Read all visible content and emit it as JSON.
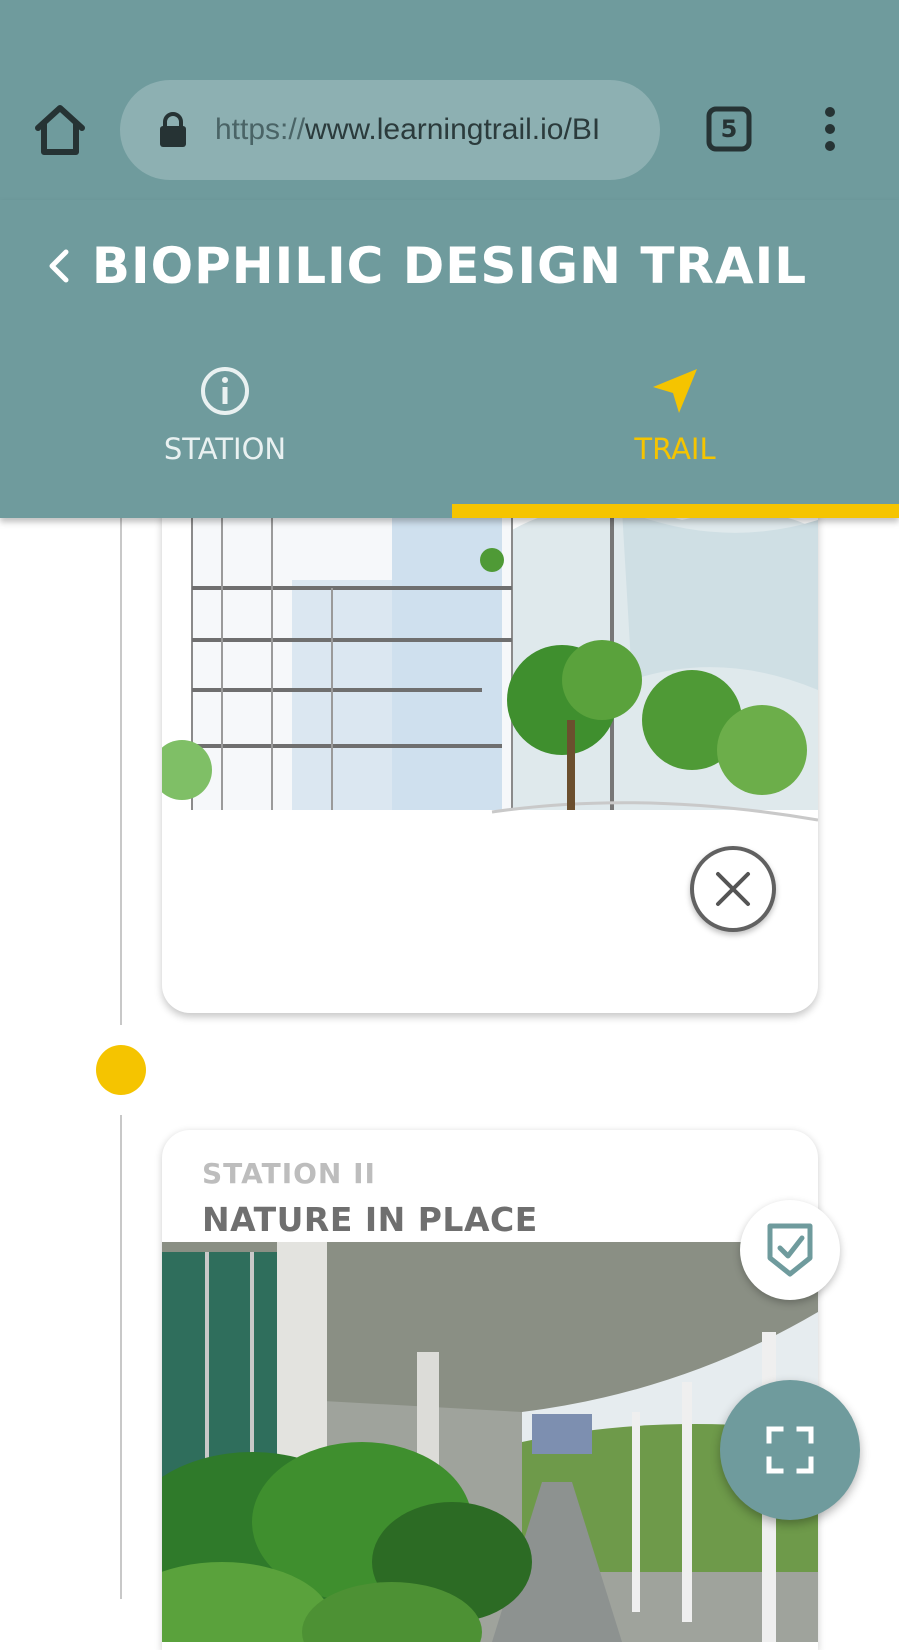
{
  "browser": {
    "url_scheme": "https://",
    "url_rest": "www.learningtrail.io/BI",
    "tab_count": "5"
  },
  "header": {
    "title": "BIOPHILIC DESIGN TRAIL",
    "tabs": [
      {
        "label": "STATION",
        "icon": "info-icon",
        "selected": false
      },
      {
        "label": "TRAIL",
        "icon": "navigation-arrow-icon",
        "selected": true
      }
    ]
  },
  "stations": [
    {
      "number": "",
      "title": "",
      "image": "building-section-drawing"
    },
    {
      "number": "STATION II",
      "title": "NATURE IN PLACE",
      "image": "covered-walkway-with-plants-photo"
    }
  ],
  "colors": {
    "primary": "#6f9b9d",
    "accent": "#f5c400",
    "text_muted": "#bdbdbd",
    "text_dark": "#6f6f6f"
  }
}
